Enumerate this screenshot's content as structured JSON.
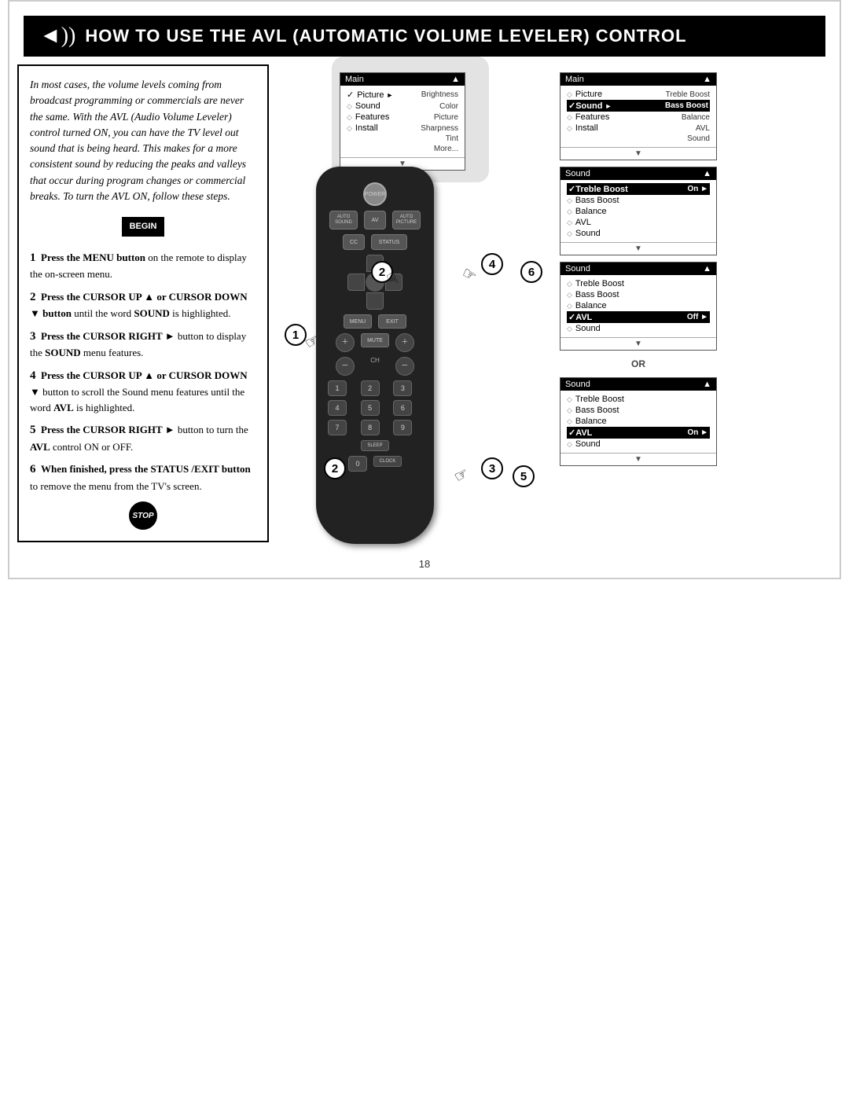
{
  "page": {
    "page_number": "18"
  },
  "header": {
    "title": "How to Use the AVL (Automatic Volume Leveler) Control",
    "icon": "◄))"
  },
  "left_panel": {
    "intro_text": "In most cases, the volume levels coming from broadcast programming or commercials are never the same. With the AVL (Audio Volume Leveler) control turned ON, you can have the TV level out sound that is being heard. This makes for a more consistent sound by reducing the peaks and valleys that occur during program changes or commercial breaks. To turn the AVL ON, follow these steps.",
    "begin_label": "BEGIN",
    "steps": [
      {
        "num": "1",
        "text": "Press the MENU button on the remote to display the on-screen menu."
      },
      {
        "num": "2",
        "text": "Press the CURSOR UP ▲ or CURSOR DOWN ▼ button until the word SOUND is highlighted."
      },
      {
        "num": "3",
        "text": "Press the CURSOR RIGHT ► button to display the SOUND menu features."
      },
      {
        "num": "4",
        "text": "Press the CURSOR UP ▲ or CURSOR DOWN ▼ button to scroll the Sound menu features until the word AVL is highlighted."
      },
      {
        "num": "5",
        "text": "Press the CURSOR RIGHT ► button to turn the AVL control ON or OFF."
      },
      {
        "num": "6",
        "text": "When finished, press the STATUS/EXIT button to remove the menu from the TV's screen."
      }
    ],
    "stop_label": "STOP"
  },
  "menus": {
    "main_menu": {
      "header": "Main",
      "header_arrow": "▲",
      "rows": [
        {
          "prefix": "✓",
          "label": "Picture",
          "value": "►",
          "sub": "Brightness"
        },
        {
          "prefix": "◇",
          "label": "Sound",
          "value": "",
          "sub": "Color"
        },
        {
          "prefix": "◇",
          "label": "Features",
          "value": "",
          "sub": "Picture"
        },
        {
          "prefix": "◇",
          "label": "Install",
          "value": "",
          "sub": "Sharpness"
        },
        {
          "prefix": "",
          "label": "",
          "value": "",
          "sub": "Tint"
        },
        {
          "prefix": "",
          "label": "",
          "value": "",
          "sub": "More..."
        }
      ],
      "footer": "▼"
    },
    "main_menu2": {
      "header": "Main",
      "header_arrow": "▲",
      "rows": [
        {
          "prefix": "◇",
          "label": "Picture",
          "value": "",
          "sub": "Treble Boost"
        },
        {
          "prefix": "✓",
          "label": "Sound",
          "value": "►",
          "sub": "Bass Boost"
        },
        {
          "prefix": "◇",
          "label": "Features",
          "value": "",
          "sub": "Balance"
        },
        {
          "prefix": "◇",
          "label": "Install",
          "value": "",
          "sub": "AVL"
        },
        {
          "prefix": "",
          "label": "",
          "value": "",
          "sub": "Sound"
        }
      ],
      "footer": "▼"
    },
    "sound_menu1": {
      "header": "Sound",
      "header_arrow": "▲",
      "rows": [
        {
          "prefix": "✓",
          "label": "Treble Boost",
          "value": "On ►"
        },
        {
          "prefix": "◇",
          "label": "Bass Boost",
          "value": ""
        },
        {
          "prefix": "◇",
          "label": "Balance",
          "value": ""
        },
        {
          "prefix": "◇",
          "label": "AVL",
          "value": ""
        },
        {
          "prefix": "◇",
          "label": "Sound",
          "value": ""
        }
      ],
      "footer": "▼"
    },
    "sound_menu2": {
      "header": "Sound",
      "header_arrow": "▲",
      "rows": [
        {
          "prefix": "◇",
          "label": "Treble Boost",
          "value": ""
        },
        {
          "prefix": "◇",
          "label": "Bass Boost",
          "value": ""
        },
        {
          "prefix": "◇",
          "label": "Balance",
          "value": ""
        },
        {
          "prefix": "✓",
          "label": "AVL",
          "value": "Off ►"
        },
        {
          "prefix": "◇",
          "label": "Sound",
          "value": ""
        }
      ],
      "footer": "▼"
    },
    "sound_menu3": {
      "header": "Sound",
      "header_arrow": "▲",
      "rows": [
        {
          "prefix": "◇",
          "label": "Treble Boost",
          "value": ""
        },
        {
          "prefix": "◇",
          "label": "Bass Boost",
          "value": ""
        },
        {
          "prefix": "◇",
          "label": "Balance",
          "value": ""
        },
        {
          "prefix": "✓",
          "label": "AVL",
          "value": "On ►"
        },
        {
          "prefix": "◇",
          "label": "Sound",
          "value": ""
        }
      ],
      "footer": "▼"
    },
    "or_label": "OR"
  },
  "remote": {
    "buttons": {
      "power": "POWER",
      "auto_sound": "AUTO\nSOUND",
      "av": "AV",
      "auto_picture": "AUTO\nPICTURE",
      "cc": "CC",
      "status": "STATUS",
      "menu": "MENU",
      "exit": "EXIT",
      "mute": "MUTE",
      "ch_label": "CH",
      "sleep": "SLEEP",
      "clock": "CLOCK",
      "numpad": [
        "1",
        "2",
        "3",
        "4",
        "5",
        "6",
        "7",
        "8",
        "9",
        "0"
      ]
    },
    "step_numbers": [
      "1",
      "2",
      "3",
      "4",
      "5",
      "6"
    ]
  }
}
